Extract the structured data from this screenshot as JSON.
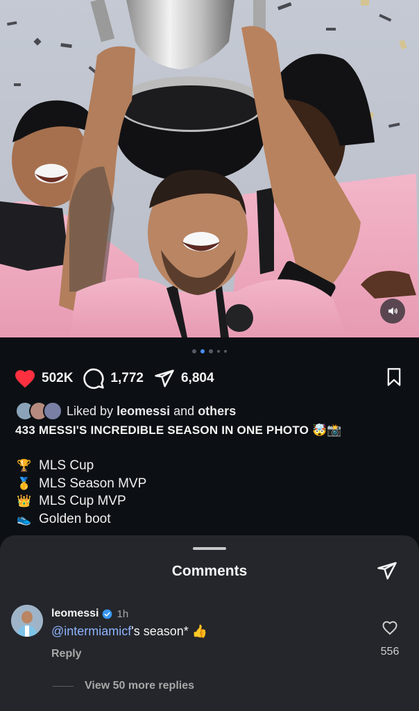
{
  "post": {
    "carousel": {
      "count": 5,
      "active_index": 1
    }
  },
  "actions": {
    "likes": "502K",
    "comments": "1,772",
    "shares": "6,804"
  },
  "liked_by": {
    "prefix": "Liked by",
    "user": "leomessi",
    "connector": "and",
    "others": "others"
  },
  "caption": {
    "title": "433 MESSI'S INCREDIBLE SEASON IN ONE PHOTO 🤯📸",
    "items": [
      {
        "icon": "🏆",
        "text": "MLS Cup"
      },
      {
        "icon": "🥇",
        "text": "MLS Season MVP"
      },
      {
        "icon": "👑",
        "text": "MLS Cup MVP"
      },
      {
        "icon": "👟",
        "text": "Golden boot"
      }
    ]
  },
  "comments_sheet": {
    "title": "Comments",
    "comment": {
      "username": "leomessi",
      "time": "1h",
      "mention": "@intermiamicf",
      "text": "'s season* 👍",
      "reply_label": "Reply",
      "like_count": "556"
    },
    "view_more": "View 50 more replies"
  },
  "colors": {
    "like_red": "#ff3040",
    "verified_blue": "#3897f0",
    "mention_blue": "#8fb4ff",
    "jersey_pink": "#f4b3c8"
  }
}
